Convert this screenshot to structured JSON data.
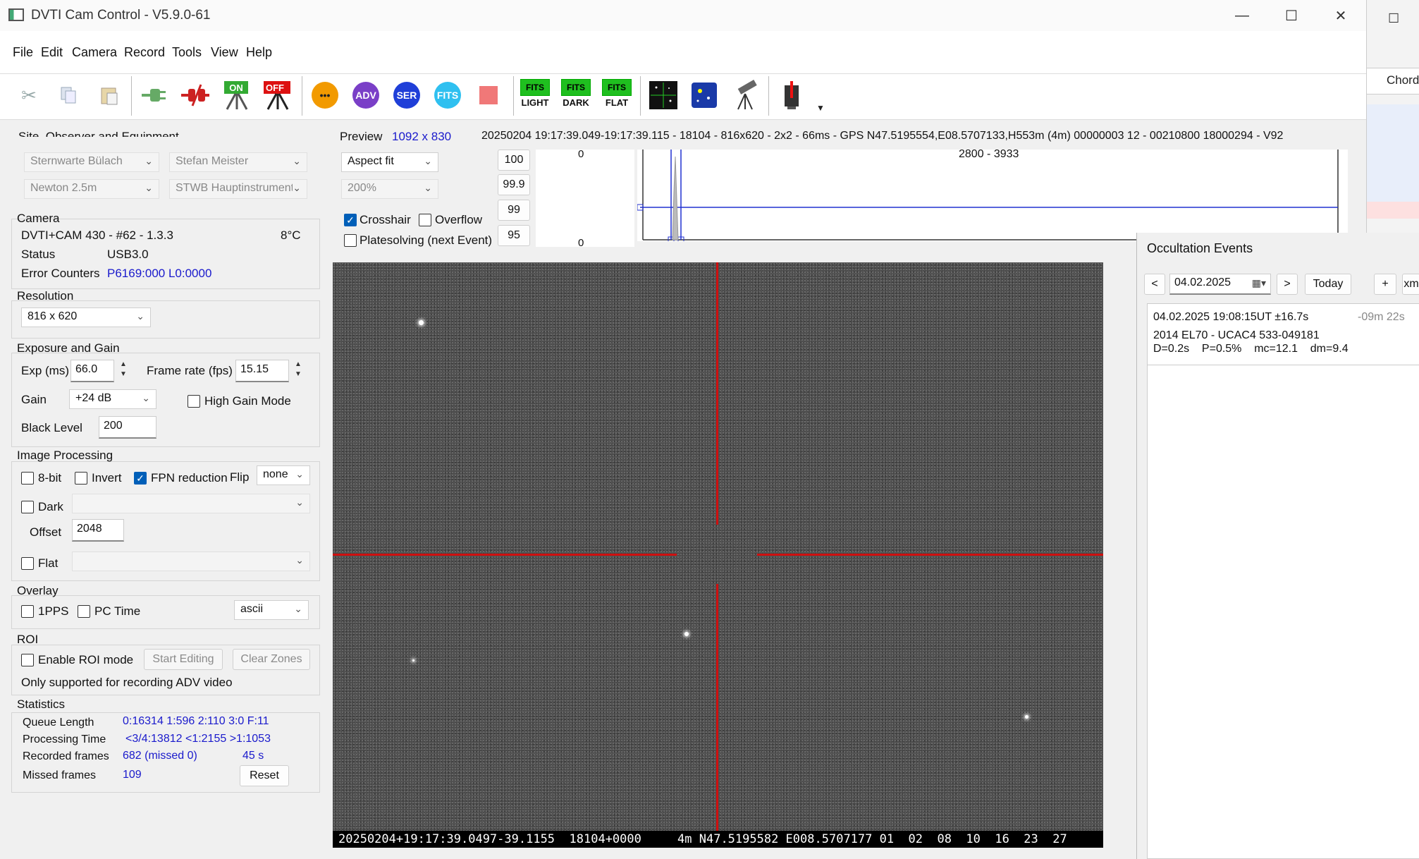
{
  "window": {
    "title": "DVTI Cam Control - V5.9.0-61",
    "minimize": "—",
    "maximize": "☐",
    "close": "✕"
  },
  "menu": [
    "File",
    "Edit",
    "Camera",
    "Record",
    "Tools",
    "View",
    "Help"
  ],
  "toolbar": {
    "adv": "ADV",
    "ser": "SER",
    "fits": "FITS",
    "fits_light_top": "FITS",
    "fits_light_bot": "LIGHT",
    "fits_dark_top": "FITS",
    "fits_dark_bot": "DARK",
    "fits_flat_top": "FITS",
    "fits_flat_bot": "FLAT",
    "on": "ON",
    "off": "OFF",
    "more": "•••"
  },
  "site": {
    "title": "Site, Observer and Equipment",
    "observatory": "Sternwarte Bülach",
    "observer": "Stefan Meister",
    "telescope": "Newton 2.5m",
    "instrument": "STWB Hauptinstrument"
  },
  "camera": {
    "title": "Camera",
    "model": "DVTI+CAM 430   -  #62   -  1.3.3",
    "temperature": "8°C",
    "status_label": "Status",
    "status_value": "USB3.0",
    "error_label": "Error Counters",
    "error_value": "P6169:000 L0:0000"
  },
  "resolution": {
    "title": "Resolution",
    "value": "816 x 620"
  },
  "exposure": {
    "title": "Exposure and Gain",
    "exp_label": "Exp (ms)",
    "exp_value": "66.0",
    "framerate_label": "Frame rate (fps)",
    "framerate_value": "15.15",
    "gain_label": "Gain",
    "gain_value": "+24 dB",
    "high_gain_label": "High Gain Mode",
    "black_label": "Black Level",
    "black_value": "200"
  },
  "image_processing": {
    "title": "Image Processing",
    "bit8": "8-bit",
    "invert": "Invert",
    "fpn": "FPN reduction",
    "flip_label": "Flip",
    "flip_value": "none",
    "dark": "Dark",
    "offset_label": "Offset",
    "offset_value": "2048",
    "flat": "Flat"
  },
  "overlay": {
    "title": "Overlay",
    "pps": "1PPS",
    "pctime": "PC Time",
    "mode": "ascii"
  },
  "roi": {
    "title": "ROI",
    "enable": "Enable ROI mode",
    "start": "Start Editing",
    "clear": "Clear Zones",
    "note": "Only supported for recording ADV video"
  },
  "statistics": {
    "title": "Statistics",
    "queue_label": "Queue Length",
    "queue_value": "0:16314   1:596   2:110   3:0   F:11",
    "proc_label": "Processing Time",
    "proc_value": "<3/4:13812  <1:2155   >1:1053",
    "rec_label": "Recorded frames",
    "rec_value": "682 (missed 0)",
    "rec_time": "45 s",
    "missed_label": "Missed frames",
    "missed_value": "109",
    "reset": "Reset"
  },
  "preview": {
    "label": "Preview",
    "size": "1092 x 830",
    "info": "20250204 19:17:39.049-19:17:39.115 - 18104 - 816x620 - 2x2 - 66ms - GPS N47.5195554,E08.5707133,H553m (4m) 00000003 12 - 00210800 18000294 - V92",
    "fit": "Aspect fit",
    "zoom": "200%",
    "crosshair": "Crosshair",
    "overflow": "Overflow",
    "platesolving": "Platesolving (next Event)",
    "pct": [
      "100",
      "99.9",
      "99",
      "95"
    ],
    "histo_top": "0",
    "histo_bottom": "0",
    "histo_range": "2800 - 3933",
    "stamp": "20250204+19:17:39.0497-39.1155  18104+0000     4m N47.5195582 E008.5707177 01  02  08  10  16  23  27"
  },
  "occultation": {
    "title": "Occultation Events",
    "prev": "<",
    "date": "04.02.2025",
    "next": ">",
    "today": "Today",
    "plus": "+",
    "xm": "xm",
    "event_time": "04.02.2025 19:08:15UT ±16.7s",
    "event_delta": "-09m 22s",
    "event_name": "2014 EL70 - UCAC4 533-049181",
    "event_detail": "D=0.2s    P=0.5%    mc=12.1    dm=9.4"
  },
  "background_window": {
    "label": "Chord"
  },
  "colors": {
    "crosshair": "#d01010",
    "link_blue": "#1a1acc",
    "checkbox_blue": "#005fb8"
  }
}
